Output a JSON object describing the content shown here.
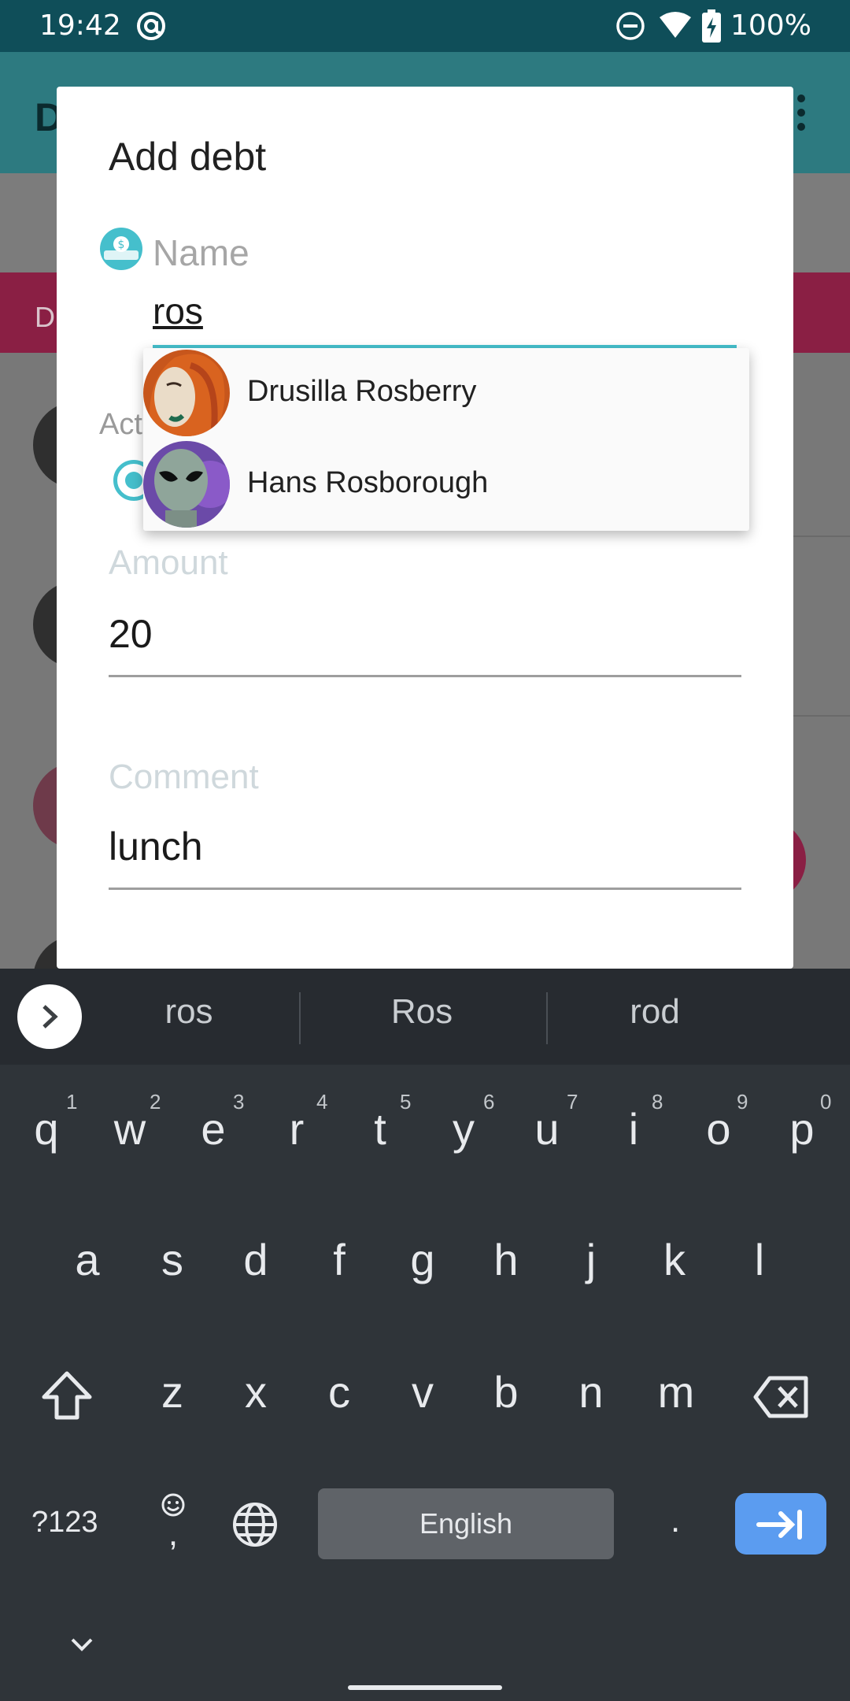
{
  "status_bar": {
    "time": "19:42",
    "battery": "100%"
  },
  "background_app": {
    "title_char": "D",
    "tab_char": "D"
  },
  "dialog": {
    "title": "Add debt",
    "name_label": "Name",
    "name_value": "ros",
    "action_label": "Act",
    "amount_label": "Amount",
    "amount_value": "20",
    "comment_label": "Comment",
    "comment_value": "lunch"
  },
  "suggestions": [
    {
      "name": "Drusilla Rosberry",
      "avatar": "red-haired-woman-avatar"
    },
    {
      "name": "Hans Rosborough",
      "avatar": "alien-avatar"
    }
  ],
  "keyboard": {
    "suggestions": [
      "ros",
      "Ros",
      "rod"
    ],
    "row1": [
      {
        "k": "q",
        "h": "1"
      },
      {
        "k": "w",
        "h": "2"
      },
      {
        "k": "e",
        "h": "3"
      },
      {
        "k": "r",
        "h": "4"
      },
      {
        "k": "t",
        "h": "5"
      },
      {
        "k": "y",
        "h": "6"
      },
      {
        "k": "u",
        "h": "7"
      },
      {
        "k": "i",
        "h": "8"
      },
      {
        "k": "o",
        "h": "9"
      },
      {
        "k": "p",
        "h": "0"
      }
    ],
    "row2": [
      "a",
      "s",
      "d",
      "f",
      "g",
      "h",
      "j",
      "k",
      "l"
    ],
    "row3": [
      "z",
      "x",
      "c",
      "v",
      "b",
      "n",
      "m"
    ],
    "symbols_label": "?123",
    "comma": ",",
    "space_label": "English",
    "period": ".",
    "accent_color": "#5b9cf0"
  },
  "colors": {
    "accent": "#45bfcc",
    "status_bar": "#0f4e59"
  }
}
